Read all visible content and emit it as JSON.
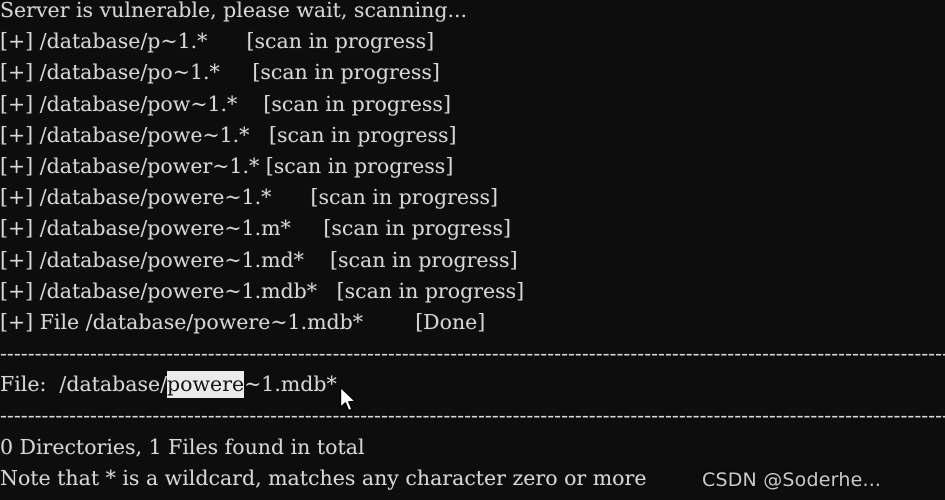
{
  "terminal": {
    "background_color": "#0d0d0d",
    "text_color": "#d6d6d6",
    "selection_background": "#ebebeb",
    "selection_text_color": "#141414",
    "header_line": "Server is vulnerable, please wait, scanning...",
    "scan_lines": [
      "[+] /database/p~1.*      [scan in progress]",
      "[+] /database/po~1.*     [scan in progress]",
      "[+] /database/pow~1.*    [scan in progress]",
      "[+] /database/powe~1.*   [scan in progress]",
      "[+] /database/power~1.* [scan in progress]",
      "[+] /database/powere~1.*      [scan in progress]",
      "[+] /database/powere~1.m*     [scan in progress]",
      "[+] /database/powere~1.md*    [scan in progress]",
      "[+] /database/powere~1.mdb*   [scan in progress]"
    ],
    "done_line": {
      "prefix": "[+] File /database/powere~1.mdb*",
      "gap": "        ",
      "status": "[Done]"
    },
    "divider": "-------------------------------------------------------------------------",
    "file_line": {
      "label": "File:  ",
      "path_prefix": "/database/",
      "selected_text": "powere",
      "path_suffix": "~1.mdb*"
    },
    "footer_lines": [
      "0 Directories, 1 Files found in total",
      "Note that * is a wildcard, matches any character zero or more"
    ],
    "watermark": "CSDN @Soderhe..."
  }
}
